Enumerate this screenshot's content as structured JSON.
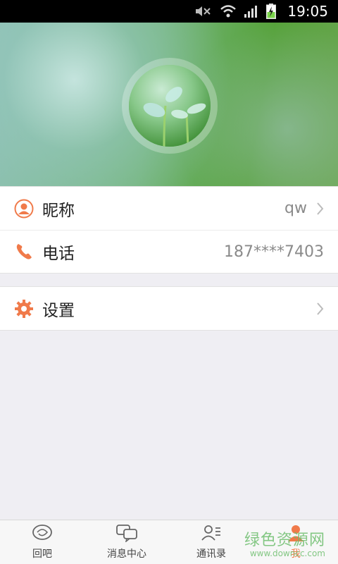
{
  "status_bar": {
    "time": "19:05",
    "icons": [
      "mute-icon",
      "wifi-icon",
      "signal-icon",
      "battery-charging-icon"
    ]
  },
  "profile": {
    "avatar_icon": "sprout-avatar"
  },
  "list": {
    "nickname": {
      "label": "昵称",
      "value": "qw",
      "icon": "person-icon"
    },
    "phone": {
      "label": "电话",
      "value": "187****7403",
      "icon": "phone-icon"
    }
  },
  "settings": {
    "label": "设置",
    "icon": "gear-icon"
  },
  "bottom_nav": {
    "items": [
      {
        "label": "回吧",
        "icon": "chat-bubble-icon"
      },
      {
        "label": "消息中心",
        "icon": "messages-icon"
      },
      {
        "label": "通讯录",
        "icon": "contacts-icon"
      },
      {
        "label": "我",
        "icon": "me-icon",
        "active": true
      }
    ]
  },
  "watermark": {
    "text_cn": "绿色资源网",
    "text_url": "www.downcc.com"
  },
  "colors": {
    "accent": "#f07a4a",
    "banner_green": "#56a23a"
  }
}
